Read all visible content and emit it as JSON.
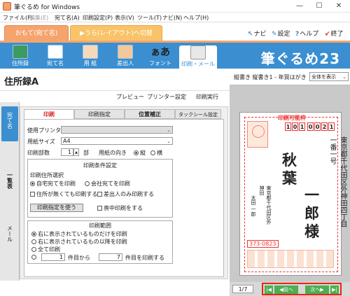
{
  "window": {
    "title": "筆ぐるめ for Windows",
    "minimize": "—",
    "maximize": "☐",
    "close": "✕"
  },
  "menu": [
    "ファイル(F)",
    "編集(E)",
    "宛て名(A)",
    "印刷設定(P)",
    "表示(V)",
    "ツール(T)",
    "ナビ(N)",
    "ヘルプ(H)"
  ],
  "modes": {
    "active": "おもて(宛て名)",
    "switch": "▶うら(レイアウト)へ切替"
  },
  "top_links": {
    "navi": "ナビ",
    "settings": "設定",
    "help": "ヘルプ",
    "exit": "終了"
  },
  "toolbar": {
    "items": [
      "住所録",
      "宛て名",
      "用 紙",
      "差出人",
      "フォント",
      "印刷・メール"
    ],
    "font_glyph": "ぁあ",
    "brand": "筆ぐるめ23"
  },
  "page_title": "住所録A",
  "actions": [
    "プレビュー",
    "プリンター設定",
    "印刷実行"
  ],
  "side_tabs": [
    "宛て名",
    "一覧表",
    "メール"
  ],
  "tabs": [
    "印刷",
    "印刷指定",
    "位置補正",
    "タックシール設定"
  ],
  "form": {
    "printer_label": "使用プリンター",
    "paper_size_label": "用紙サイズ",
    "paper_size_value": "A4",
    "copies_label": "印刷部数",
    "copies_value": "1",
    "copies_unit": "部",
    "orientation_label": "用紙の向き",
    "orientation_options": [
      "縦",
      "横"
    ],
    "conditions_title": "印刷条件設定",
    "address_select_label": "印刷住所選択",
    "address_options": [
      "自宅宛てを印刷",
      "会社宛てを印刷"
    ],
    "check_no_address": "住所が無くても印刷する",
    "check_sender_only": "差出人のみ印刷する",
    "print_spec_button": "印刷指定を使う",
    "check_mourning": "喪中印刷をする",
    "range_title": "印刷範囲",
    "range_options": [
      "右に表示されているものだけを印刷",
      "右に表示されているもの以降を印刷",
      "全て印刷"
    ],
    "range_from": "1",
    "range_from_unit": "件目から",
    "range_to": "7",
    "range_to_unit": "件目を印刷する"
  },
  "preview": {
    "label": "縦書き 縦書き1 - 年賀はがき",
    "view_select": "全体を表示",
    "printable": "印刷可能枠",
    "zip": [
      "1",
      "0",
      "1",
      "0",
      "0",
      "2",
      "1"
    ],
    "address": "東京都千代田区外神田四丁目一番一号",
    "name_lines": [
      "秋",
      "葉",
      "一",
      "郎",
      "様"
    ],
    "sender_address": "東京都千代田区外神田",
    "sender_name": "太田 一郎",
    "sender_zip": "373-0823",
    "page": "1/7",
    "prev": "前へ",
    "next": "次へ"
  }
}
